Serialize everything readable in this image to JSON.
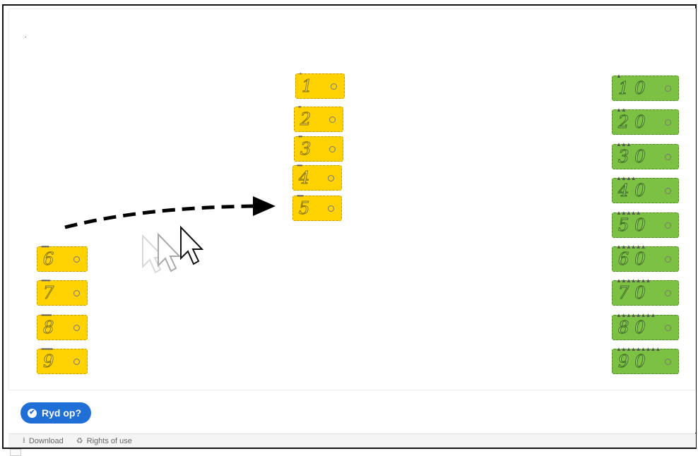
{
  "stage": {
    "dot": ".",
    "yellow_top": [
      {
        "label": "1",
        "dots": "•"
      },
      {
        "label": "2",
        "dots": "••"
      },
      {
        "label": "3",
        "dots": "•••"
      },
      {
        "label": "4",
        "dots": "••••"
      },
      {
        "label": "5",
        "dots": "•••••"
      }
    ],
    "yellow_left": [
      {
        "label": "6",
        "dots": "••••••"
      },
      {
        "label": "7",
        "dots": "•••••••"
      },
      {
        "label": "8",
        "dots": "••••••••"
      },
      {
        "label": "9",
        "dots": "•••••••••"
      }
    ],
    "green_right": [
      {
        "label": "10",
        "dots": "▲"
      },
      {
        "label": "20",
        "dots": "▲▲"
      },
      {
        "label": "30",
        "dots": "▲▲▲"
      },
      {
        "label": "40",
        "dots": "▲▲▲▲"
      },
      {
        "label": "50",
        "dots": "▲▲▲▲▲"
      },
      {
        "label": "60",
        "dots": "▲▲▲▲▲▲"
      },
      {
        "label": "70",
        "dots": "▲▲▲▲▲▲▲"
      },
      {
        "label": "80",
        "dots": "▲▲▲▲▲▲▲▲"
      },
      {
        "label": "90",
        "dots": "▲▲▲▲▲▲▲▲▲"
      }
    ]
  },
  "actions": {
    "ryd_label": "Ryd op?"
  },
  "footer": {
    "download_label": "Download",
    "rights_label": "Rights of use"
  },
  "colors": {
    "yellow_card": "#ffd200",
    "green_card": "#7cc143",
    "button_blue": "#1f6fd6"
  },
  "icons": {
    "button": "check-circle-icon",
    "download": "download-icon",
    "rights": "handshake-icon",
    "pointer": "mouse-cursor-icon"
  }
}
